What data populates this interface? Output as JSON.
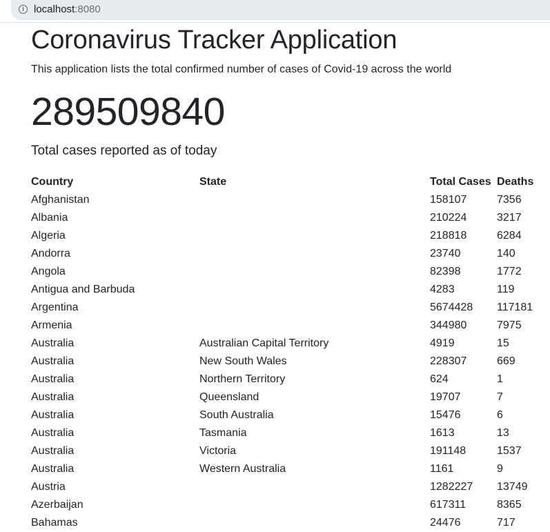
{
  "browser": {
    "host": "localhost",
    "port": ":8080"
  },
  "header": {
    "title": "Coronavirus Tracker Application",
    "subtitle": "This application lists the total confirmed number of cases of Covid-19 across the world"
  },
  "summary": {
    "total": "289509840",
    "caption": "Total cases reported as of today"
  },
  "table": {
    "headers": [
      "Country",
      "State",
      "Total Cases",
      "Deaths"
    ],
    "rows": [
      [
        "Afghanistan",
        "",
        "158107",
        "7356"
      ],
      [
        "Albania",
        "",
        "210224",
        "3217"
      ],
      [
        "Algeria",
        "",
        "218818",
        "6284"
      ],
      [
        "Andorra",
        "",
        "23740",
        "140"
      ],
      [
        "Angola",
        "",
        "82398",
        "1772"
      ],
      [
        "Antigua and Barbuda",
        "",
        "4283",
        "119"
      ],
      [
        "Argentina",
        "",
        "5674428",
        "117181"
      ],
      [
        "Armenia",
        "",
        "344980",
        "7975"
      ],
      [
        "Australia",
        "Australian Capital Territory",
        "4919",
        "15"
      ],
      [
        "Australia",
        "New South Wales",
        "228307",
        "669"
      ],
      [
        "Australia",
        "Northern Territory",
        "624",
        "1"
      ],
      [
        "Australia",
        "Queensland",
        "19707",
        "7"
      ],
      [
        "Australia",
        "South Australia",
        "15476",
        "6"
      ],
      [
        "Australia",
        "Tasmania",
        "1613",
        "13"
      ],
      [
        "Australia",
        "Victoria",
        "191148",
        "1537"
      ],
      [
        "Australia",
        "Western Australia",
        "1161",
        "9"
      ],
      [
        "Austria",
        "",
        "1282227",
        "13749"
      ],
      [
        "Azerbaijan",
        "",
        "617311",
        "8365"
      ],
      [
        "Bahamas",
        "",
        "24476",
        "717"
      ]
    ]
  }
}
